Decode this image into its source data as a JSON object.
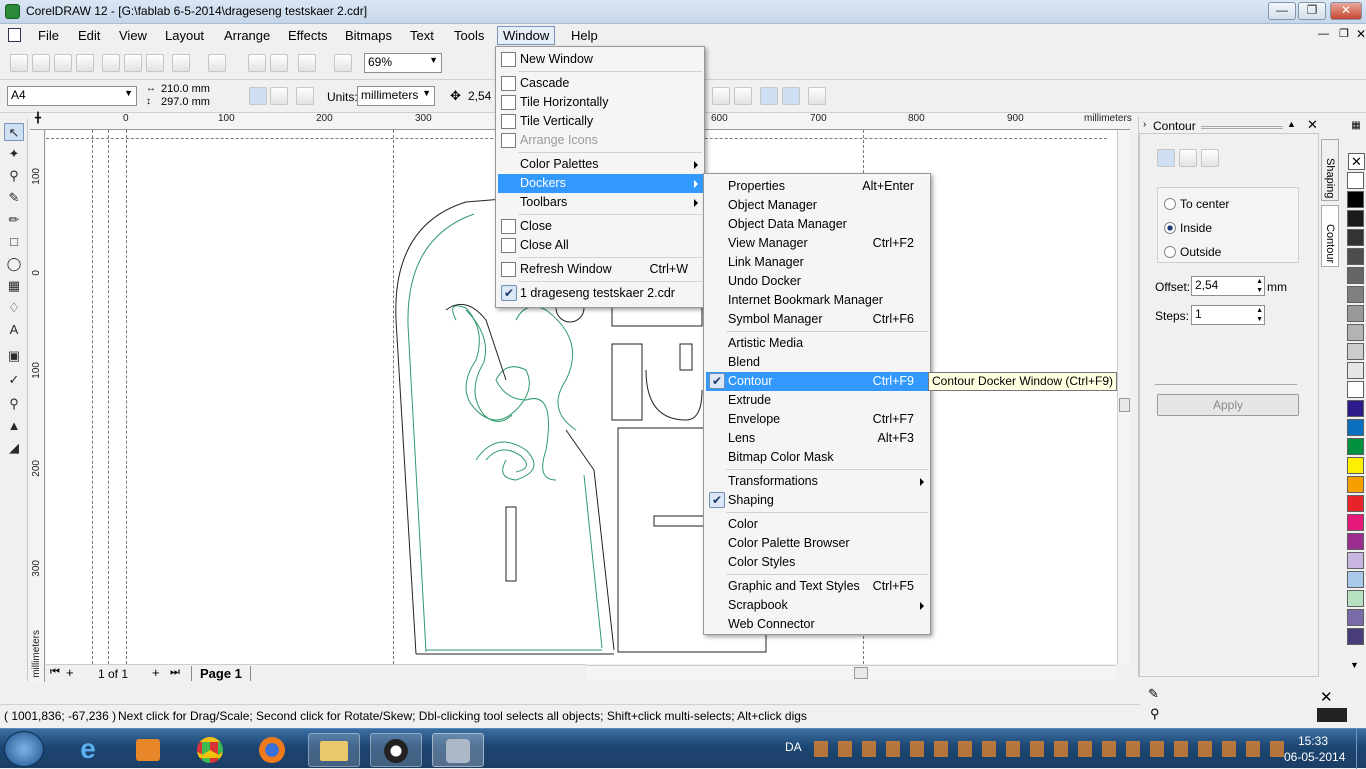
{
  "window": {
    "title": "CorelDRAW 12 - [G:\\fablab 6-5-2014\\drageseng testskaer 2.cdr]"
  },
  "menubar": [
    "File",
    "Edit",
    "View",
    "Layout",
    "Arrange",
    "Effects",
    "Bitmaps",
    "Text",
    "Tools",
    "Window",
    "Help"
  ],
  "toolbar": {
    "zoom": "69%",
    "page_size": "A4",
    "width": "210.0 mm",
    "height": "297.0 mm",
    "units_label": "Units:",
    "units": "millimeters",
    "nudge": "2,54"
  },
  "rulers": {
    "h_ticks": [
      "0",
      "100",
      "200",
      "300",
      "600",
      "700",
      "800",
      "900"
    ],
    "h_unit": "millimeters",
    "v_ticks": [
      "100",
      "0",
      "100",
      "200",
      "300"
    ],
    "v_unit": "millimeters"
  },
  "window_menu": [
    {
      "label": "New Window",
      "icon": true
    },
    {
      "label": "Cascade",
      "icon": true
    },
    {
      "label": "Tile Horizontally",
      "icon": true
    },
    {
      "label": "Tile Vertically",
      "icon": true
    },
    {
      "label": "Arrange Icons",
      "icon": true,
      "disabled": true
    },
    {
      "label": "Color Palettes",
      "submenu": true
    },
    {
      "label": "Dockers",
      "submenu": true,
      "selected": true
    },
    {
      "label": "Toolbars",
      "submenu": true
    },
    {
      "label": "Close",
      "icon": true
    },
    {
      "label": "Close All",
      "icon": true
    },
    {
      "label": "Refresh Window",
      "shortcut": "Ctrl+W",
      "icon": true
    },
    {
      "label": "1 drageseng testskaer 2.cdr",
      "checked": true
    }
  ],
  "dockers_menu": [
    {
      "label": "Properties",
      "shortcut": "Alt+Enter"
    },
    {
      "label": "Object Manager"
    },
    {
      "label": "Object Data Manager"
    },
    {
      "label": "View Manager",
      "shortcut": "Ctrl+F2"
    },
    {
      "label": "Link Manager"
    },
    {
      "label": "Undo Docker"
    },
    {
      "label": "Internet Bookmark Manager"
    },
    {
      "label": "Symbol Manager",
      "shortcut": "Ctrl+F6"
    },
    {
      "label": "Artistic Media"
    },
    {
      "label": "Blend"
    },
    {
      "label": "Contour",
      "shortcut": "Ctrl+F9",
      "checked": true,
      "selected": true
    },
    {
      "label": "Extrude"
    },
    {
      "label": "Envelope",
      "shortcut": "Ctrl+F7"
    },
    {
      "label": "Lens",
      "shortcut": "Alt+F3"
    },
    {
      "label": "Bitmap Color Mask"
    },
    {
      "label": "Transformations",
      "submenu": true
    },
    {
      "label": "Shaping",
      "checked": true
    },
    {
      "label": "Color"
    },
    {
      "label": "Color Palette Browser"
    },
    {
      "label": "Color Styles"
    },
    {
      "label": "Graphic and Text Styles",
      "shortcut": "Ctrl+F5"
    },
    {
      "label": "Scrapbook",
      "submenu": true
    },
    {
      "label": "Web Connector"
    }
  ],
  "tooltip": "Contour Docker Window (Ctrl+F9)",
  "docker": {
    "title": "Contour",
    "options": [
      "To center",
      "Inside",
      "Outside"
    ],
    "selected": "Inside",
    "offset_label": "Offset:",
    "offset": "2,54",
    "offset_unit": "mm",
    "steps_label": "Steps:",
    "steps": "1",
    "apply": "Apply",
    "tabs": [
      "Shaping",
      "Contour"
    ]
  },
  "page_nav": {
    "count": "1 of 1",
    "page": "Page 1"
  },
  "status": {
    "coords": "( 1001,836; -67,236 )",
    "hint": "Next click for Drag/Scale; Second click for Rotate/Skew; Dbl-clicking tool selects all objects; Shift+click multi-selects; Alt+click digs"
  },
  "taskbar": {
    "lang": "DA",
    "time": "15:33",
    "date": "06-05-2014"
  },
  "palette_colors": [
    "#ffffff",
    "#000000",
    "#1a1a1a",
    "#333333",
    "#4d4d4d",
    "#666666",
    "#808080",
    "#999999",
    "#b3b3b3",
    "#cccccc",
    "#e6e6e6",
    "#ffffff",
    "#2e1a8a",
    "#0b6fc0",
    "#00923f",
    "#ffef00",
    "#f5a000",
    "#e8232a",
    "#e6197a",
    "#9b2d8f",
    "#c8b6e0",
    "#a9c8ea",
    "#b6e0c0",
    "#7a6aa8",
    "#4a3c7a"
  ]
}
